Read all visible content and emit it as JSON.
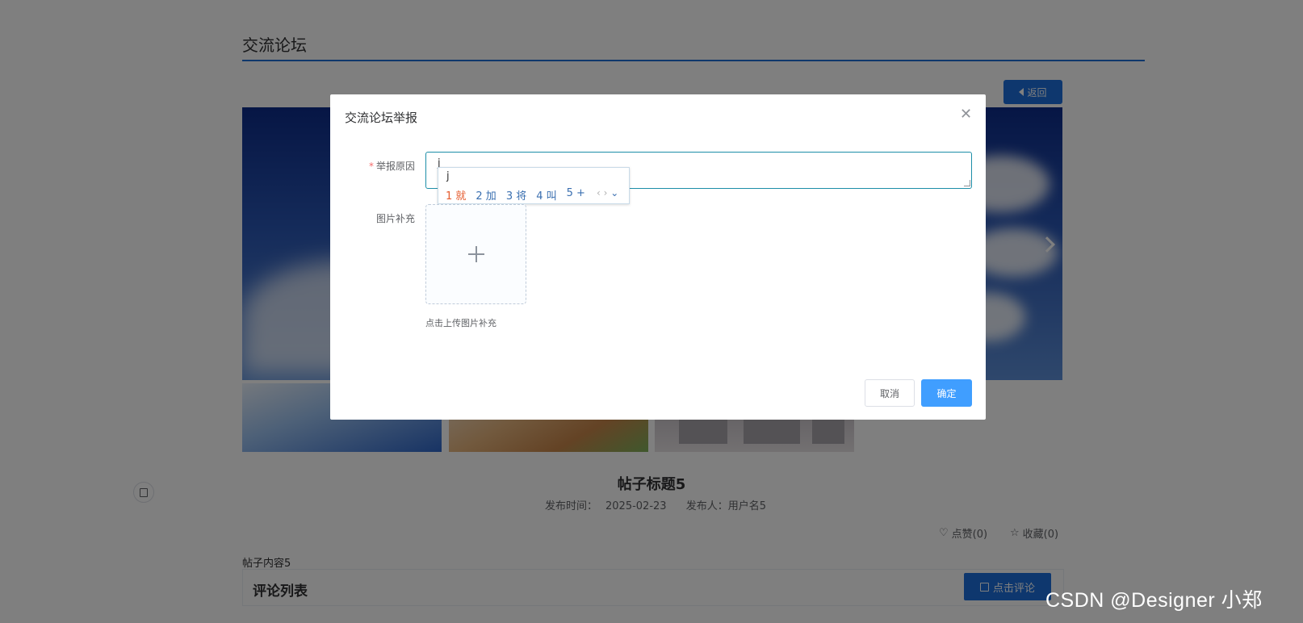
{
  "page": {
    "forum_title": "交流论坛",
    "back_button": "返回",
    "post": {
      "title": "帖子标题5",
      "publish_time_label": "发布时间：",
      "publish_time": "2025-02-23",
      "publisher_label": "发布人：",
      "publisher": "用户名5",
      "like_label": "点赞(0)",
      "favorite_label": "收藏(0)",
      "content": "帖子内容5"
    },
    "comments": {
      "heading": "评论列表",
      "comment_button": "点击评论"
    }
  },
  "dialog": {
    "title": "交流论坛举报",
    "close_icon": "close-icon",
    "reason_label": "举报原因",
    "required_mark": "*",
    "reason_value": "j",
    "image_label": "图片补充",
    "upload_tip": "点击上传图片补充",
    "cancel_button": "取消",
    "confirm_button": "确定"
  },
  "ime": {
    "composition": "j",
    "candidates": [
      "1 就",
      "2 加",
      "3 将",
      "4 叫",
      "5 +"
    ],
    "nav": "‹ ›"
  },
  "watermark": "CSDN @Designer 小郑",
  "colors": {
    "accent": "#1d6fdc",
    "confirm": "#409eff",
    "overlay": "rgba(0,0,0,0.5)"
  }
}
